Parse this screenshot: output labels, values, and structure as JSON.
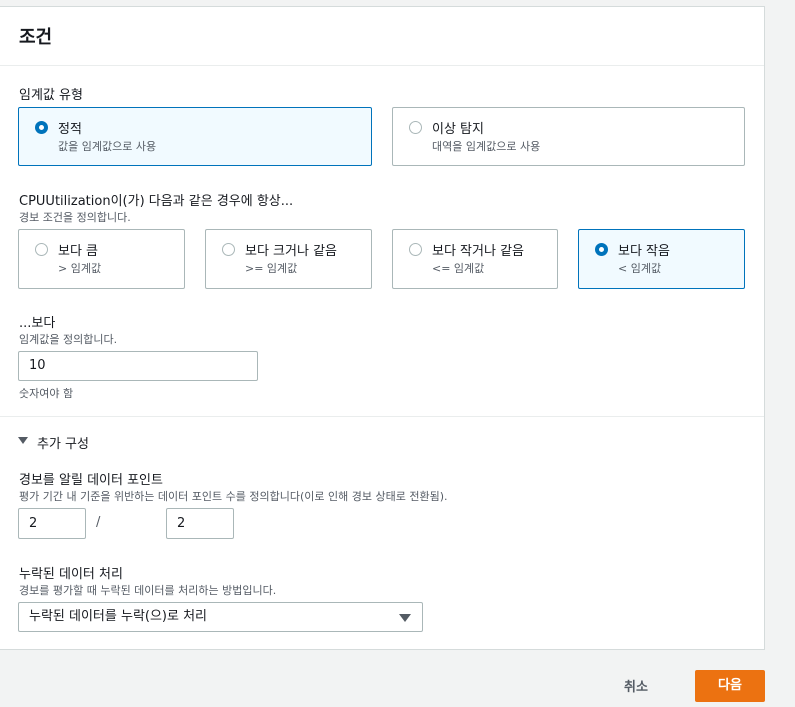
{
  "panel": {
    "title": "조건"
  },
  "threshold_type": {
    "label": "임계값 유형",
    "options": [
      {
        "title": "정적",
        "subtitle": "값을 임계값으로 사용",
        "selected": true
      },
      {
        "title": "이상 탐지",
        "subtitle": "대역을 임계값으로 사용",
        "selected": false
      }
    ]
  },
  "condition": {
    "label": "CPUUtilization이(가) 다음과 같은 경우에 항상...",
    "description": "경보 조건을 정의합니다.",
    "options": [
      {
        "title": "보다 큼",
        "subtitle": "> 임계값",
        "selected": false
      },
      {
        "title": "보다 크거나 같음",
        "subtitle": ">= 임계값",
        "selected": false
      },
      {
        "title": "보다 작거나 같음",
        "subtitle": "<= 임계값",
        "selected": false
      },
      {
        "title": "보다 작음",
        "subtitle": "< 임계값",
        "selected": true
      }
    ]
  },
  "threshold": {
    "label": "...보다",
    "description": "임계값을 정의합니다.",
    "value": "10",
    "hint": "숫자여야 함"
  },
  "additional": {
    "toggle_label": "추가 구성",
    "datapoints": {
      "label": "경보를 알릴 데이터 포인트",
      "description": "평가 기간 내 기준을 위반하는 데이터 포인트 수를 정의합니다(이로 인해 경보 상태로 전환됨).",
      "value1": "2",
      "separator": "/",
      "value2": "2"
    },
    "missing_data": {
      "label": "누락된 데이터 처리",
      "description": "경보를 평가할 때 누락된 데이터를 처리하는 방법입니다.",
      "selected": "누락된 데이터를 누락(으)로 처리"
    }
  },
  "footer": {
    "cancel_label": "취소",
    "next_label": "다음"
  },
  "colors": {
    "accent": "#0073bb",
    "primary_button": "#ec7211"
  }
}
